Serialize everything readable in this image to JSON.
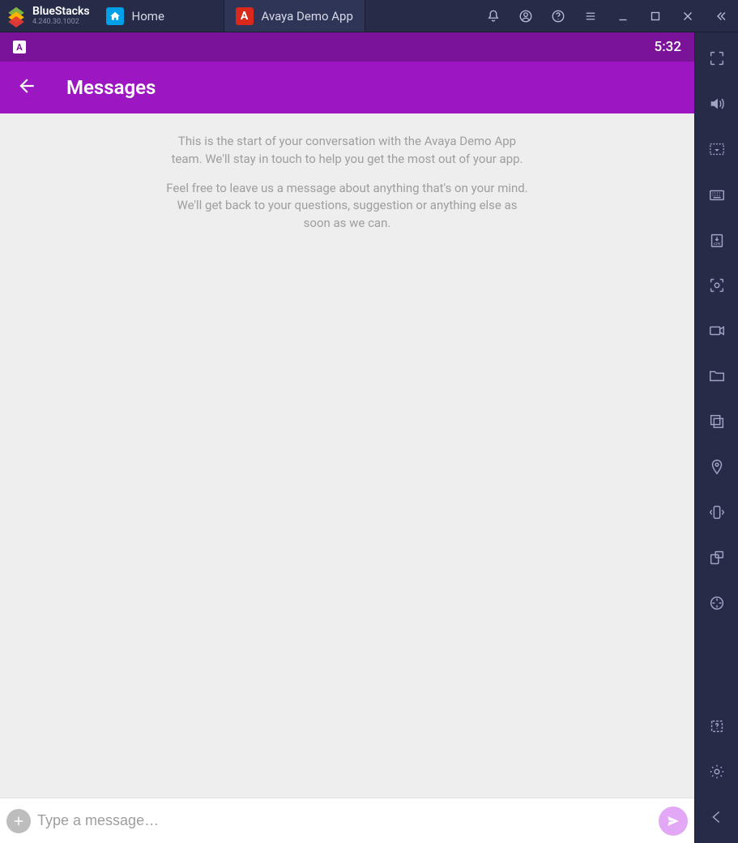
{
  "emulator": {
    "brand": "BlueStacks",
    "version": "4.240.30.1002",
    "tabs": [
      {
        "label": "Home"
      },
      {
        "label": "Avaya Demo App"
      }
    ]
  },
  "device": {
    "statusbar": {
      "time": "5:32",
      "note_badge": "A"
    },
    "appbar": {
      "title": "Messages"
    },
    "messages": {
      "intro1": "This is the start of your conversation with the Avaya Demo App team. We'll stay in touch to help you get the most out of your app.",
      "intro2": "Feel free to leave us a message about anything that's on your mind. We'll get back to your questions, suggestion or anything else as soon as we can."
    },
    "composer": {
      "placeholder": "Type a message…"
    }
  }
}
